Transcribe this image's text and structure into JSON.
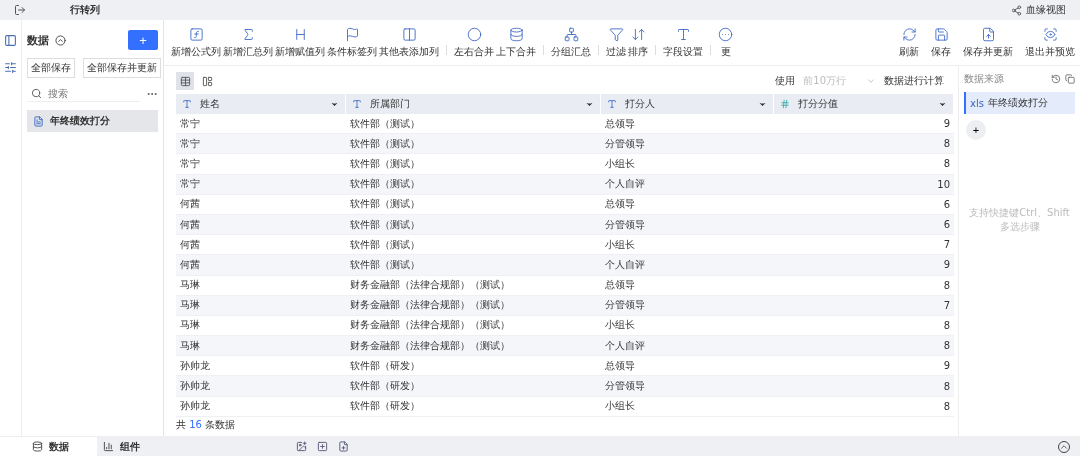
{
  "topbar": {
    "title": "行转列",
    "right_link": "血缘视图"
  },
  "left_panel": {
    "title": "数据",
    "add_label": "+",
    "buttons": [
      "全部保存",
      "全部保存并更新"
    ],
    "search": {
      "placeholder": "搜索"
    },
    "items": [
      {
        "label": "年终绩效打分",
        "selected": true
      }
    ]
  },
  "toolbar": {
    "groups": [
      [
        {
          "label": "新增公式列",
          "kind": "fx"
        },
        {
          "label": "新增汇总列",
          "kind": "sigma"
        },
        {
          "label": "新增赋值列",
          "kind": "assign"
        },
        {
          "label": "条件标签列",
          "kind": "flag"
        },
        {
          "label": "其他表添加列",
          "kind": "addcol"
        }
      ],
      [
        {
          "label": "左右合并",
          "kind": "lr"
        },
        {
          "label": "上下合并",
          "kind": "ud"
        }
      ],
      [
        {
          "label": "分组汇总",
          "kind": "group"
        }
      ],
      [
        {
          "label": "过滤",
          "kind": "filter"
        },
        {
          "label": "排序",
          "kind": "sort"
        }
      ],
      [
        {
          "label": "字段设置",
          "kind": "field"
        }
      ],
      [
        {
          "label": "更",
          "kind": "more"
        }
      ]
    ],
    "right": [
      {
        "label": "刷新",
        "kind": "refresh"
      },
      {
        "label": "保存",
        "kind": "save"
      },
      {
        "label": "保存并更新",
        "kind": "saveupdate"
      },
      {
        "label": "退出并预览",
        "kind": "preview"
      }
    ]
  },
  "view_tabs": [
    {
      "kind": "table",
      "selected": true
    },
    {
      "kind": "layout",
      "selected": false
    }
  ],
  "compute": {
    "prefix": "使用",
    "select_placeholder": "前10万行",
    "suffix": "数据进行计算"
  },
  "table": {
    "columns": [
      {
        "label": "姓名",
        "kind": "text"
      },
      {
        "label": "所属部门",
        "kind": "text"
      },
      {
        "label": "打分人",
        "kind": "text"
      },
      {
        "label": "打分分值",
        "kind": "number"
      }
    ],
    "rows": [
      [
        "常宁",
        "软件部（测试）",
        "总领导",
        "9"
      ],
      [
        "常宁",
        "软件部（测试）",
        "分管领导",
        "8"
      ],
      [
        "常宁",
        "软件部（测试）",
        "小组长",
        "8"
      ],
      [
        "常宁",
        "软件部（测试）",
        "个人自评",
        "10"
      ],
      [
        "何茜",
        "软件部（测试）",
        "总领导",
        "6"
      ],
      [
        "何茜",
        "软件部（测试）",
        "分管领导",
        "6"
      ],
      [
        "何茜",
        "软件部（测试）",
        "小组长",
        "7"
      ],
      [
        "何茜",
        "软件部（测试）",
        "个人自评",
        "9"
      ],
      [
        "马琳",
        "财务金融部（法律合规部）（测试）",
        "总领导",
        "8"
      ],
      [
        "马琳",
        "财务金融部（法律合规部）（测试）",
        "分管领导",
        "7"
      ],
      [
        "马琳",
        "财务金融部（法律合规部）（测试）",
        "小组长",
        "8"
      ],
      [
        "马琳",
        "财务金融部（法律合规部）（测试）",
        "个人自评",
        "8"
      ],
      [
        "孙帅龙",
        "软件部（研发）",
        "总领导",
        "9"
      ],
      [
        "孙帅龙",
        "软件部（研发）",
        "分管领导",
        "8"
      ],
      [
        "孙帅龙",
        "软件部（研发）",
        "小组长",
        "8"
      ]
    ],
    "footer": {
      "prefix": "共",
      "count": "16",
      "suffix": "条数据"
    }
  },
  "right_panel": {
    "title": "数据来源",
    "steps": [
      {
        "tag": "xls",
        "label": "年终绩效打分",
        "selected": true
      }
    ],
    "add_label": "+",
    "hint": "支持快捷键Ctrl、Shift多选步骤"
  },
  "bottom_tabs": [
    {
      "label": "数据",
      "kind": "db",
      "selected": true
    },
    {
      "label": "组件",
      "kind": "chart",
      "selected": false
    }
  ]
}
